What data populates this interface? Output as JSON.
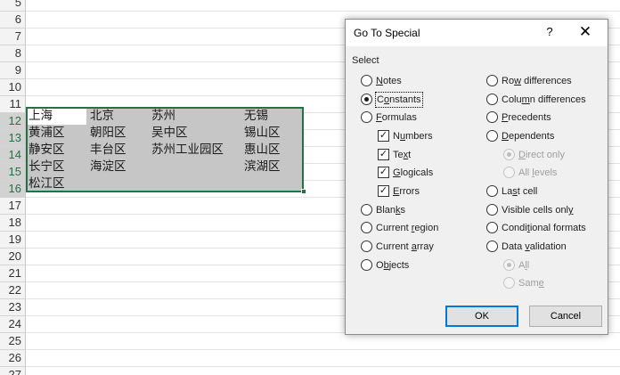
{
  "sheet": {
    "row_numbers": [
      "5",
      "6",
      "7",
      "8",
      "9",
      "10",
      "11",
      "12",
      "13",
      "14",
      "15",
      "16",
      "17",
      "18",
      "19",
      "20",
      "21",
      "22",
      "23",
      "24",
      "25",
      "26",
      "27"
    ],
    "cells": {
      "r12": [
        "上海",
        "北京",
        "苏州",
        "无锡"
      ],
      "r13": [
        "黄浦区",
        "朝阳区",
        "吴中区",
        "锡山区"
      ],
      "r14": [
        "静安区",
        "丰台区",
        "苏州工业园区",
        "惠山区"
      ],
      "r15": [
        "长宁区",
        "海淀区",
        "滨湖区"
      ],
      "r16": [
        "松江区"
      ]
    },
    "accent_color": "#217346"
  },
  "dialog": {
    "title": "Go To Special",
    "help_icon": "?",
    "close_icon": "✕",
    "select_label": "Select",
    "left_options": [
      {
        "pre": "",
        "acc": "N",
        "post": "otes"
      },
      {
        "pre": "C",
        "acc": "o",
        "post": "nstants"
      },
      {
        "pre": "",
        "acc": "F",
        "post": "ormulas"
      },
      {
        "pre": "N",
        "acc": "u",
        "post": "mbers"
      },
      {
        "pre": "Te",
        "acc": "x",
        "post": "t"
      },
      {
        "pre": "",
        "acc": "G",
        "post": "logicals"
      },
      {
        "pre": "",
        "acc": "E",
        "post": "rrors"
      },
      {
        "pre": "Blan",
        "acc": "k",
        "post": "s"
      },
      {
        "pre": "Current ",
        "acc": "r",
        "post": "egion"
      },
      {
        "pre": "Current ",
        "acc": "a",
        "post": "rray"
      },
      {
        "pre": "O",
        "acc": "b",
        "post": "jects"
      }
    ],
    "right_options": [
      {
        "pre": "Ro",
        "acc": "w",
        "post": " differences"
      },
      {
        "pre": "Colu",
        "acc": "m",
        "post": "n differences"
      },
      {
        "pre": "",
        "acc": "P",
        "post": "recedents"
      },
      {
        "pre": "",
        "acc": "D",
        "post": "ependents"
      },
      {
        "pre": "",
        "acc": "D",
        "post": "irect only"
      },
      {
        "pre": "All ",
        "acc": "l",
        "post": "evels"
      },
      {
        "pre": "La",
        "acc": "s",
        "post": "t cell"
      },
      {
        "pre": "Visible cells onl",
        "acc": "y",
        "post": ""
      },
      {
        "pre": "Condi",
        "acc": "t",
        "post": "ional formats"
      },
      {
        "pre": "Data ",
        "acc": "v",
        "post": "alidation"
      },
      {
        "pre": "A",
        "acc": "l",
        "post": "l"
      },
      {
        "pre": "Sam",
        "acc": "e",
        "post": ""
      }
    ],
    "ok_label": "OK",
    "cancel_label": "Cancel"
  }
}
